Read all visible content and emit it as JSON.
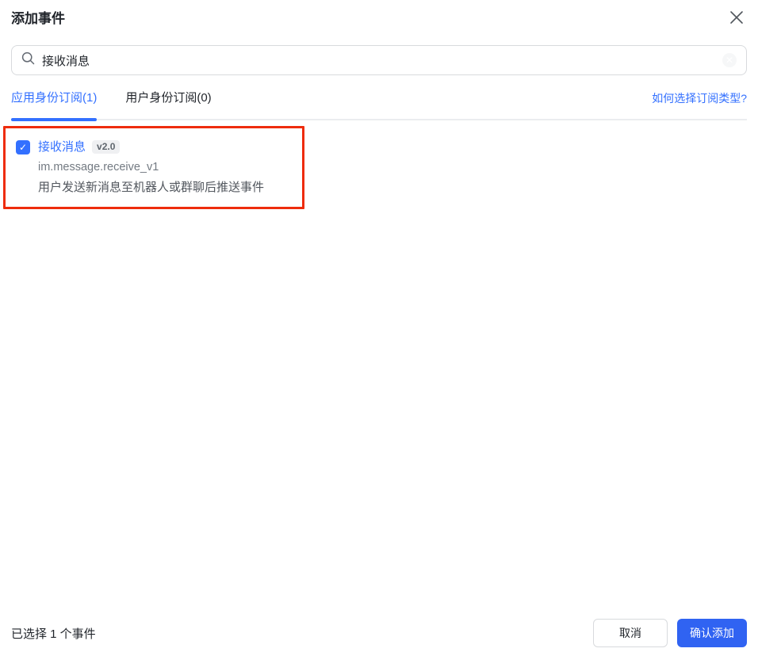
{
  "dialog": {
    "title": "添加事件"
  },
  "search": {
    "value": "接收消息",
    "icon": "search-icon",
    "clear_icon": "clear-circle-icon"
  },
  "tabs": [
    {
      "label": "应用身份订阅(1)",
      "active": true
    },
    {
      "label": "用户身份订阅(0)",
      "active": false
    }
  ],
  "help_link": {
    "label": "如何选择订阅类型?"
  },
  "events": [
    {
      "checked": true,
      "check_glyph": "✓",
      "title": "接收消息",
      "version_badge": "v2.0",
      "code": "im.message.receive_v1",
      "description": "用户发送新消息至机器人或群聊后推送事件",
      "annotated": true
    }
  ],
  "footer": {
    "selection_summary": "已选择 1 个事件",
    "cancel_label": "取消",
    "confirm_label": "确认添加"
  },
  "icons": {
    "close": "close-icon",
    "search": "search-icon",
    "clear": "clear-circle-icon",
    "checkbox_check": "check-icon",
    "clear_glyph": "✕"
  },
  "colors": {
    "accent_blue": "#3370ff",
    "confirm_button_blue": "#3063f2",
    "annotation_red": "#ee2c0c",
    "text_primary": "#1f2329",
    "text_secondary": "#737a82",
    "badge_bg": "#eff0f2",
    "border_gray": "#d8dadd",
    "tab_divider": "#ebedef"
  }
}
